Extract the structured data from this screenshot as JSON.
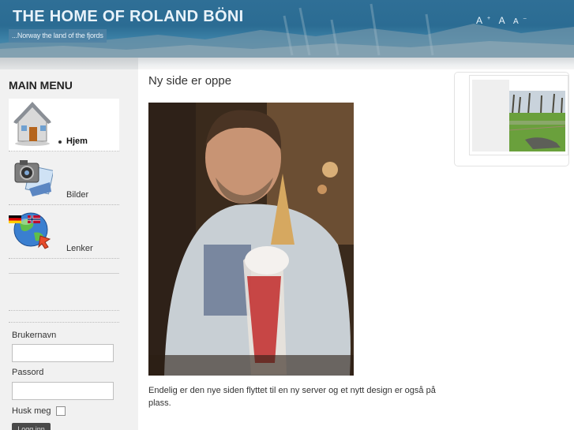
{
  "header": {
    "title": "THE HOME OF ROLAND BÖNI",
    "tagline": "...Norway the land of the fjords",
    "font_controls": {
      "increase": "A",
      "increase_sup": "+",
      "reset": "A",
      "decrease": "A",
      "decrease_sup": "–"
    }
  },
  "sidebar": {
    "menu_title": "MAIN MENU",
    "items": [
      {
        "label": "Hjem",
        "icon": "house-icon",
        "active": true
      },
      {
        "label": "Bilder",
        "icon": "camera-icon",
        "active": false
      },
      {
        "label": "Lenker",
        "icon": "globe-icon",
        "active": false
      }
    ],
    "flags": [
      {
        "icon": "german-flag-icon"
      },
      {
        "icon": "norwegian-flag-icon"
      }
    ],
    "login": {
      "username_label": "Brukernavn",
      "password_label": "Passord",
      "remember_label": "Husk meg",
      "button_label": "Logg inn"
    }
  },
  "main": {
    "article_title": "Ny side er oppe",
    "article_text": "Endelig er den nye siden flyttet til en ny server og et nytt design er også på plass."
  },
  "colors": {
    "header_blue": "#2b6c93",
    "sidebar_bg": "#f1f1f1",
    "text": "#333333"
  }
}
